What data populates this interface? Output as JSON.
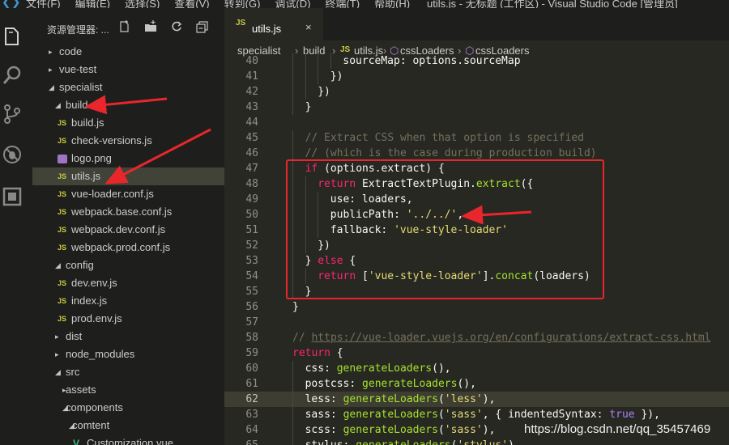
{
  "titlebar": {
    "logo": "❮❯",
    "menu": [
      "文件(F)",
      "编辑(E)",
      "选择(S)",
      "查看(V)",
      "转到(G)",
      "调试(D)",
      "终端(T)",
      "帮助(H)"
    ],
    "window_title": "utils.js - 无标题 (工作区) - Visual Studio Code [管理员]"
  },
  "activity_bar": {
    "icons": [
      "files-icon",
      "search-icon",
      "source-control-icon",
      "debug-icon",
      "extensions-icon"
    ]
  },
  "sidebar": {
    "title": "资源管理器: ...",
    "actions": [
      "new-file-icon",
      "new-folder-icon",
      "refresh-icon",
      "collapse-all-icon"
    ],
    "tree": [
      {
        "label": "code",
        "type": "folder",
        "depth": 0,
        "expanded": false
      },
      {
        "label": "vue-test",
        "type": "folder",
        "depth": 0,
        "expanded": false
      },
      {
        "label": "specialist",
        "type": "folder",
        "depth": 0,
        "expanded": true
      },
      {
        "label": "build",
        "type": "folder",
        "depth": 1,
        "expanded": true
      },
      {
        "label": "build.js",
        "type": "js",
        "depth": 2
      },
      {
        "label": "check-versions.js",
        "type": "js",
        "depth": 2
      },
      {
        "label": "logo.png",
        "type": "png",
        "depth": 2
      },
      {
        "label": "utils.js",
        "type": "js",
        "depth": 2,
        "selected": true
      },
      {
        "label": "vue-loader.conf.js",
        "type": "js",
        "depth": 2
      },
      {
        "label": "webpack.base.conf.js",
        "type": "js",
        "depth": 2
      },
      {
        "label": "webpack.dev.conf.js",
        "type": "js",
        "depth": 2
      },
      {
        "label": "webpack.prod.conf.js",
        "type": "js",
        "depth": 2
      },
      {
        "label": "config",
        "type": "folder",
        "depth": 1,
        "expanded": true
      },
      {
        "label": "dev.env.js",
        "type": "js",
        "depth": 2
      },
      {
        "label": "index.js",
        "type": "js",
        "depth": 2
      },
      {
        "label": "prod.env.js",
        "type": "js",
        "depth": 2
      },
      {
        "label": "dist",
        "type": "folder",
        "depth": 1,
        "expanded": false
      },
      {
        "label": "node_modules",
        "type": "folder",
        "depth": 1,
        "expanded": false
      },
      {
        "label": "src",
        "type": "folder",
        "depth": 1,
        "expanded": true
      },
      {
        "label": "assets",
        "type": "folder",
        "depth": 2,
        "expanded": false
      },
      {
        "label": "components",
        "type": "folder",
        "depth": 2,
        "expanded": true
      },
      {
        "label": "comtent",
        "type": "folder",
        "depth": 3,
        "expanded": true
      },
      {
        "label": "Customization.vue",
        "type": "vue",
        "depth": 4
      }
    ]
  },
  "editor": {
    "tab": {
      "icon": "JS",
      "label": "utils.js",
      "close": "×"
    },
    "breadcrumbs": [
      "specialist",
      "build",
      "utils.js",
      "cssLoaders",
      "cssLoaders"
    ],
    "current_line": "62",
    "lines": [
      {
        "n": "40",
        "indent": 4,
        "tokens": [
          [
            "",
            "sourceMap: options.sourceMap"
          ]
        ]
      },
      {
        "n": "41",
        "indent": 3,
        "tokens": [
          [
            "",
            "})"
          ]
        ]
      },
      {
        "n": "42",
        "indent": 2,
        "tokens": [
          [
            "",
            "})"
          ]
        ]
      },
      {
        "n": "43",
        "indent": 1,
        "tokens": [
          [
            "",
            "}"
          ]
        ]
      },
      {
        "n": "44",
        "indent": 0,
        "tokens": []
      },
      {
        "n": "45",
        "indent": 1,
        "tokens": [
          [
            "c",
            "// Extract CSS when that option is specified"
          ]
        ]
      },
      {
        "n": "46",
        "indent": 1,
        "tokens": [
          [
            "c",
            "// (which is the case during production build)"
          ]
        ]
      },
      {
        "n": "47",
        "indent": 1,
        "tokens": [
          [
            "k",
            "if"
          ],
          [
            "",
            " (options.extract) {"
          ]
        ]
      },
      {
        "n": "48",
        "indent": 2,
        "tokens": [
          [
            "k",
            "return"
          ],
          [
            "",
            " ExtractTextPlugin."
          ],
          [
            "f",
            "extract"
          ],
          [
            "",
            "({"
          ]
        ]
      },
      {
        "n": "49",
        "indent": 3,
        "tokens": [
          [
            "",
            "use: loaders,"
          ]
        ]
      },
      {
        "n": "50",
        "indent": 3,
        "tokens": [
          [
            "",
            "publicPath: "
          ],
          [
            "s",
            "'../../'"
          ],
          [
            "",
            ","
          ]
        ]
      },
      {
        "n": "51",
        "indent": 3,
        "tokens": [
          [
            "",
            "fallback: "
          ],
          [
            "s",
            "'vue-style-loader'"
          ]
        ]
      },
      {
        "n": "52",
        "indent": 2,
        "tokens": [
          [
            "",
            "})"
          ]
        ]
      },
      {
        "n": "53",
        "indent": 1,
        "tokens": [
          [
            "",
            "} "
          ],
          [
            "k",
            "else"
          ],
          [
            "",
            " {"
          ]
        ]
      },
      {
        "n": "54",
        "indent": 2,
        "tokens": [
          [
            "k",
            "return"
          ],
          [
            "",
            " ["
          ],
          [
            "s",
            "'vue-style-loader'"
          ],
          [
            "",
            "]."
          ],
          [
            "f",
            "concat"
          ],
          [
            "",
            "(loaders)"
          ]
        ]
      },
      {
        "n": "55",
        "indent": 1,
        "tokens": [
          [
            "",
            "}"
          ]
        ]
      },
      {
        "n": "56",
        "indent": 0,
        "tokens": [
          [
            "",
            "}"
          ]
        ]
      },
      {
        "n": "57",
        "indent": 0,
        "tokens": []
      },
      {
        "n": "58",
        "indent": 0,
        "tokens": [
          [
            "c",
            "// "
          ],
          [
            "u",
            "https://vue-loader.vuejs.org/en/configurations/extract-css.html"
          ]
        ]
      },
      {
        "n": "59",
        "indent": 0,
        "tokens": [
          [
            "k",
            "return"
          ],
          [
            "",
            " {"
          ]
        ]
      },
      {
        "n": "60",
        "indent": 1,
        "tokens": [
          [
            "",
            "css: "
          ],
          [
            "f",
            "generateLoaders"
          ],
          [
            "",
            "(),"
          ]
        ]
      },
      {
        "n": "61",
        "indent": 1,
        "tokens": [
          [
            "",
            "postcss: "
          ],
          [
            "f",
            "generateLoaders"
          ],
          [
            "",
            "(),"
          ]
        ]
      },
      {
        "n": "62",
        "indent": 1,
        "tokens": [
          [
            "",
            "less: "
          ],
          [
            "f",
            "generateLoaders"
          ],
          [
            "",
            "("
          ],
          [
            "s",
            "'less'"
          ],
          [
            "",
            "),"
          ]
        ]
      },
      {
        "n": "63",
        "indent": 1,
        "tokens": [
          [
            "",
            "sass: "
          ],
          [
            "f",
            "generateLoaders"
          ],
          [
            "",
            "("
          ],
          [
            "s",
            "'sass'"
          ],
          [
            "",
            ", { indentedSyntax: "
          ],
          [
            "b",
            "true"
          ],
          [
            "",
            " }),"
          ]
        ]
      },
      {
        "n": "64",
        "indent": 1,
        "tokens": [
          [
            "",
            "scss: "
          ],
          [
            "f",
            "generateLoaders"
          ],
          [
            "",
            "("
          ],
          [
            "s",
            "'sass'"
          ],
          [
            "",
            "),"
          ]
        ]
      },
      {
        "n": "65",
        "indent": 1,
        "tokens": [
          [
            "",
            "stylus: "
          ],
          [
            "f",
            "generateLoaders"
          ],
          [
            "",
            "("
          ],
          [
            "s",
            "'stylus'"
          ],
          [
            "",
            "),"
          ]
        ]
      }
    ]
  },
  "annotations": {
    "color": "#e8262b"
  },
  "watermark": "https://blog.csdn.net/qq_35457469"
}
